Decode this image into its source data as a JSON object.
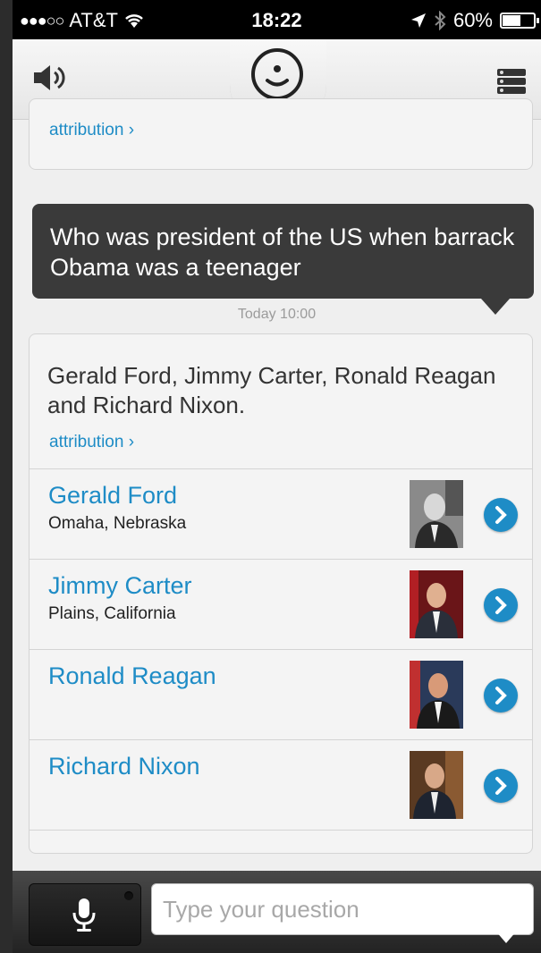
{
  "status_bar": {
    "signal": "●●●○○",
    "carrier": "AT&T",
    "time": "18:22",
    "battery_text": "60%",
    "battery_level": 0.6
  },
  "nav": {
    "speaker_icon": "speaker-icon",
    "assistant_icon": "smiley-face-icon",
    "menu_icon": "menu-list-icon"
  },
  "previous_card": {
    "attribution": "attribution"
  },
  "user_message": {
    "text": "Who was president of the US when barrack Obama was a teenager",
    "timestamp": "Today 10:00"
  },
  "answer": {
    "text": "Gerald Ford, Jimmy Carter, Ronald Reagan and Richard Nixon.",
    "attribution": "attribution",
    "results": [
      {
        "name": "Gerald Ford",
        "place": "Omaha, Nebraska"
      },
      {
        "name": "Jimmy Carter",
        "place": "Plains, California"
      },
      {
        "name": "Ronald Reagan",
        "place": ""
      },
      {
        "name": "Richard Nixon",
        "place": ""
      }
    ]
  },
  "input": {
    "placeholder": "Type your question"
  },
  "colors": {
    "accent": "#1e8cc6",
    "bubble": "#3a3a3a",
    "background": "#efefef"
  }
}
